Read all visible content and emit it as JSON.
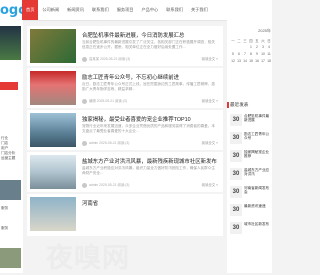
{
  "header": {
    "logo": "ogo",
    "nav": [
      "首页",
      "公司新闻",
      "新闻资讯",
      "联系我们",
      "服务项目",
      "产品中心",
      "联系我们",
      "关于我们"
    ]
  },
  "left": {
    "texts": [
      "行业",
      "门店",
      "用户",
      "门店分析",
      "运营主题",
      "...",
      "",
      "服务",
      "服务"
    ]
  },
  "articles": [
    {
      "title": "合肥坠机事件最新进展，今日消防发展汇总",
      "desc": "当前合肥坠机事件的最新进展引发了广泛关注，各相关部门正在积极展开调查，相关信息正在逐步公开。据悉，相关单位正在全力做好后续处置工作...",
      "author": "高某某",
      "date": "2025-05-21",
      "views": "阅读:(3)",
      "more": "阅读全文 »"
    },
    {
      "title": "励志工匠青年公众号，不忘初心继续前进",
      "desc": "近日，励志工匠青年公众号正式上线，旨在挖掘身边的工匠故事，传播工匠精神，激励广大青年勤学苦练、精益求精...",
      "author": "编辑",
      "date": "2025-05-21",
      "views": "阅读:(3)",
      "more": "阅读全文 »"
    },
    {
      "title": "独家揭秘，最受业者喜爱的宠企业推荐TOP10",
      "desc": "宠物行业近年来发展迅速，众多企业凭借优质的产品和服务赢得了消费者的喜爱。本文盘点了最受业者喜爱的十大企业...",
      "author": "admin",
      "date": "2025-05-21",
      "views": "阅读:(3)",
      "more": "阅读全文 »"
    },
    {
      "title": "盐城东方产业对洪汛风暴，最新残疾新现城市社区新发布",
      "desc": "盐城东方产业积极应对洪汛风暴，组织力量全力做好防汛抢险工作，确保人民群众生命财产安全...",
      "author": "admin",
      "date": "2025-05-21",
      "views": "阅读:(3)",
      "more": "阅读全文 »"
    },
    {
      "title": "河南省",
      "desc": "",
      "author": "",
      "date": "",
      "views": "",
      "more": ""
    }
  ],
  "right": {
    "calendar_label": "2025年",
    "weekdays": [
      "一",
      "二",
      "三",
      "四",
      "五",
      "六",
      "日"
    ],
    "rows": [
      [
        "",
        "",
        "",
        "1",
        "2",
        "3",
        "4"
      ],
      [
        "5",
        "6",
        "7",
        "8",
        "9",
        "10",
        "11"
      ],
      [
        "12",
        "13",
        "14",
        "15",
        "16",
        "17",
        "18"
      ]
    ],
    "section": "最近发表",
    "items": [
      {
        "num": "30",
        "text": "合肥坠机事件最新进展"
      },
      {
        "num": "30",
        "text": "励志工匠青年公众号"
      },
      {
        "num": "30",
        "text": "独家揭秘宠企业推荐"
      },
      {
        "num": "30",
        "text": "盐城东方产业应对洪汛"
      },
      {
        "num": "30",
        "text": "河南省新闻发布会"
      },
      {
        "num": "30",
        "text": "最新资讯速递"
      },
      {
        "num": "30",
        "text": "城市社区新发布"
      }
    ]
  },
  "colors": {
    "accent": "#e53935",
    "link": "#2aa4e0"
  },
  "watermark": "夜嗅网"
}
